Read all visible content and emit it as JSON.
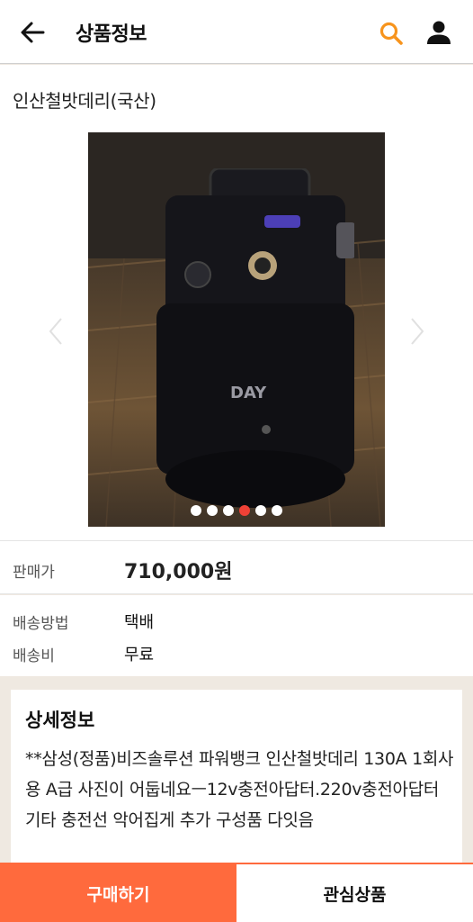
{
  "header": {
    "title": "상품정보",
    "back_icon": "arrow-left-icon",
    "search_icon": "search-icon",
    "user_icon": "user-icon",
    "accent_color": "#f7941d"
  },
  "product": {
    "name": "인산철밧데리(국산)",
    "image_brand_text": "DAY",
    "slides": {
      "count": 6,
      "active_index": 3
    }
  },
  "price": {
    "label": "판매가",
    "value": "710,000원"
  },
  "shipping": {
    "method_label": "배송방법",
    "method_value": "택배",
    "fee_label": "배송비",
    "fee_value": "무료"
  },
  "detail": {
    "title": "상세정보",
    "text": "**삼성(정품)비즈솔루션 파워뱅크 인산철밧데리 130A 1회사용 A급 사진이 어둡네요ㅡ12v충전아답터.220v충전아답터 기타 충전선 악어집게 추가 구성품 다잇음"
  },
  "actions": {
    "buy_label": "구매하기",
    "wish_label": "관심상품",
    "buy_color": "#ff6a3d"
  }
}
